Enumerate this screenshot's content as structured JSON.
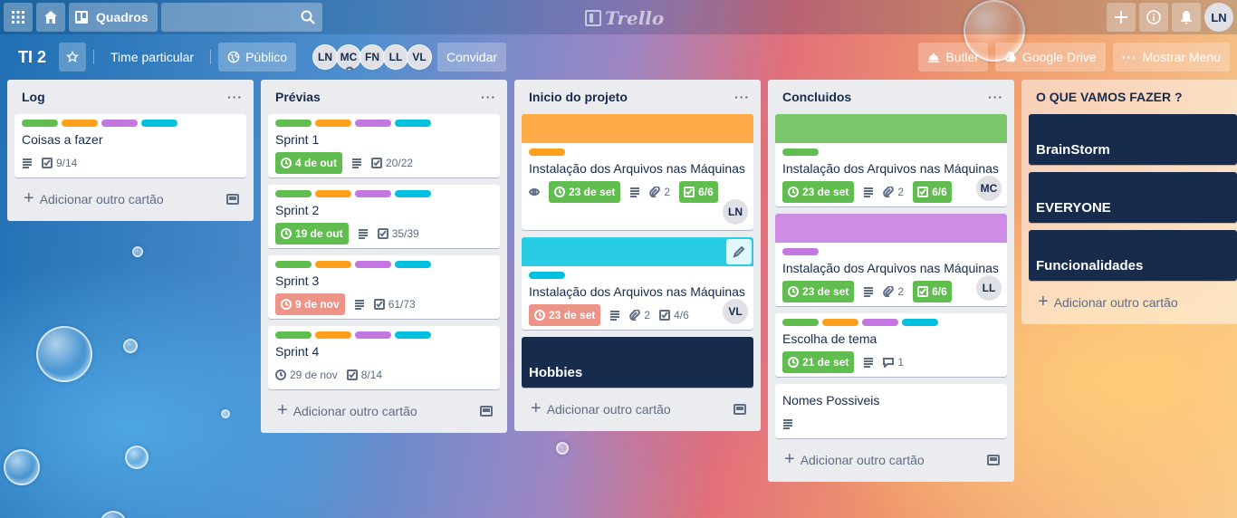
{
  "topbar": {
    "boards_label": "Quadros",
    "logo_text": "Trello",
    "user_initials": "LN"
  },
  "header": {
    "board_title": "TI 2",
    "team_label": "Time particular",
    "visibility_label": "Público",
    "members": [
      "LN",
      "MC",
      "FN",
      "LL",
      "VL"
    ],
    "invite_label": "Convidar",
    "butler_label": "Butler",
    "gdrive_label": "Google Drive",
    "menu_label": "Mostrar Menu"
  },
  "colors": {
    "green": "#61bd4f",
    "yellow": "#ffab4a",
    "orange": "#ff9f1a",
    "purple": "#c377e0",
    "sky": "#00c2e0",
    "red_due": "#ec9488",
    "dark_navy": "#172b4d",
    "cover_orange": "#ffab4a",
    "cover_cyan": "#29cce5",
    "cover_green": "#7bc86c",
    "cover_purple": "#cd8de5"
  },
  "add_card_label": "Adicionar outro cartão",
  "lists": {
    "log": {
      "title": "Log",
      "cards": [
        {
          "title": "Coisas a fazer",
          "checklist": "9/14"
        }
      ]
    },
    "previas": {
      "title": "Prévias",
      "cards": [
        {
          "title": "Sprint 1",
          "due": "4 de out",
          "checklist": "20/22"
        },
        {
          "title": "Sprint 2",
          "due": "19 de out",
          "checklist": "35/39"
        },
        {
          "title": "Sprint 3",
          "due": "9 de nov",
          "checklist": "61/73"
        },
        {
          "title": "Sprint 4",
          "due": "29 de nov",
          "checklist": "8/14"
        }
      ]
    },
    "inicio": {
      "title": "Inicio do projeto",
      "cards": [
        {
          "title": "Instalação dos Arquivos nas Máquinas",
          "due": "23 de set",
          "attachments": "2",
          "checklist": "6/6",
          "member": "LN"
        },
        {
          "title": "Instalação dos Arquivos nas Máquinas",
          "due": "23 de set",
          "attachments": "2",
          "checklist": "4/6",
          "member": "VL"
        },
        {
          "title": "Hobbies"
        }
      ]
    },
    "concluidos": {
      "title": "Concluidos",
      "cards": [
        {
          "title": "Instalação dos Arquivos nas Máquinas",
          "due": "23 de set",
          "attachments": "2",
          "checklist": "6/6",
          "member": "MC"
        },
        {
          "title": "Instalação dos Arquivos nas Máquinas",
          "due": "23 de set",
          "attachments": "2",
          "checklist": "6/6",
          "member": "LL"
        },
        {
          "title": "Escolha de tema",
          "due": "21 de set",
          "comments": "1"
        },
        {
          "title": "Nomes Possiveis"
        }
      ]
    },
    "oque": {
      "title": "O QUE VAMOS FAZER ?",
      "cards": [
        {
          "title": "BrainStorm"
        },
        {
          "title": "EVERYONE"
        },
        {
          "title": "Funcionalidades"
        }
      ]
    }
  }
}
